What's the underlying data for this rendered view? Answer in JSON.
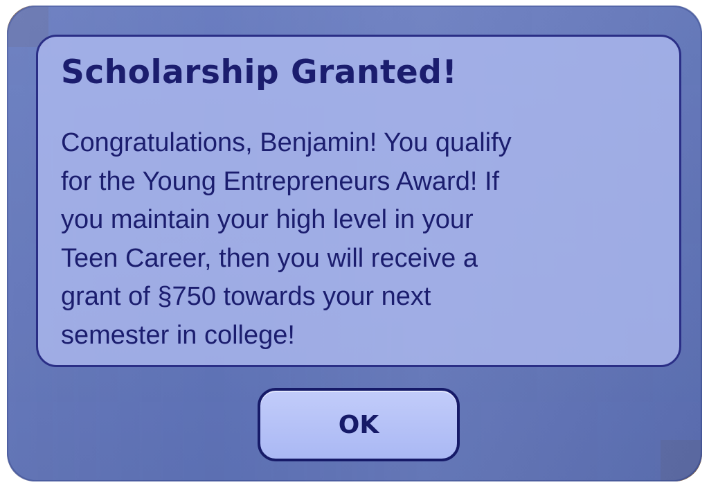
{
  "dialog": {
    "title": "Scholarship Granted!",
    "message": "Congratulations, Benjamin!  You qualify\nfor the Young Entrepreneurs Award!  If\nyou maintain your high level in your\nTeen Career, then you will receive a\ngrant of §750 towards your next\nsemester in college!",
    "ok_label": "OK"
  },
  "colors": {
    "dialog_background": "#5c72be",
    "panel_background": "#acb8ee",
    "text": "#1b1d6e",
    "border": "#2a2e86"
  }
}
